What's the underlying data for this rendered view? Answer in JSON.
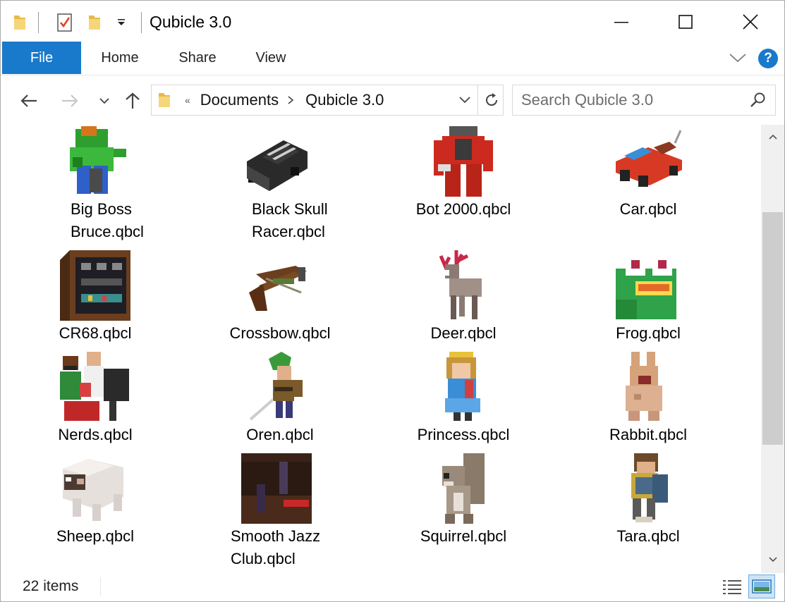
{
  "window": {
    "title": "Qubicle 3.0"
  },
  "ribbon": {
    "tabs": [
      {
        "label": "File"
      },
      {
        "label": "Home"
      },
      {
        "label": "Share"
      },
      {
        "label": "View"
      }
    ],
    "help_label": "?"
  },
  "nav": {
    "overflow_marker": "«",
    "breadcrumbs": [
      {
        "label": "Documents"
      },
      {
        "label": "Qubicle 3.0"
      }
    ],
    "search_placeholder": "Search Qubicle 3.0"
  },
  "files": [
    {
      "line1": "Big Boss",
      "line2": "Bruce.qbcl",
      "icon": "voxel-ogre-icon"
    },
    {
      "line1": "Black Skull",
      "line2": "Racer.qbcl",
      "icon": "voxel-car-black-icon"
    },
    {
      "line1": "Bot 2000.qbcl",
      "line2": "",
      "icon": "voxel-robot-icon"
    },
    {
      "line1": "Car.qbcl",
      "line2": "",
      "icon": "voxel-car-red-icon"
    },
    {
      "line1": "CR68.qbcl",
      "line2": "",
      "icon": "voxel-cabinet-icon"
    },
    {
      "line1": "Crossbow.qbcl",
      "line2": "",
      "icon": "voxel-crossbow-icon"
    },
    {
      "line1": "Deer.qbcl",
      "line2": "",
      "icon": "voxel-deer-icon"
    },
    {
      "line1": "Frog.qbcl",
      "line2": "",
      "icon": "voxel-frog-icon"
    },
    {
      "line1": "Nerds.qbcl",
      "line2": "",
      "icon": "voxel-nerds-icon"
    },
    {
      "line1": "Oren.qbcl",
      "line2": "",
      "icon": "voxel-elf-icon"
    },
    {
      "line1": "Princess.qbcl",
      "line2": "",
      "icon": "voxel-princess-icon"
    },
    {
      "line1": "Rabbit.qbcl",
      "line2": "",
      "icon": "voxel-rabbit-icon"
    },
    {
      "line1": "Sheep.qbcl",
      "line2": "",
      "icon": "voxel-sheep-icon"
    },
    {
      "line1": "Smooth Jazz",
      "line2": "Club.qbcl",
      "icon": "voxel-club-icon"
    },
    {
      "line1": "Squirrel.qbcl",
      "line2": "",
      "icon": "voxel-squirrel-icon"
    },
    {
      "line1": "Tara.qbcl",
      "line2": "",
      "icon": "voxel-warrior-icon"
    }
  ],
  "status": {
    "item_count": "22 items"
  },
  "colors": {
    "accent": "#1979ca",
    "folder": "#f0c75e"
  }
}
